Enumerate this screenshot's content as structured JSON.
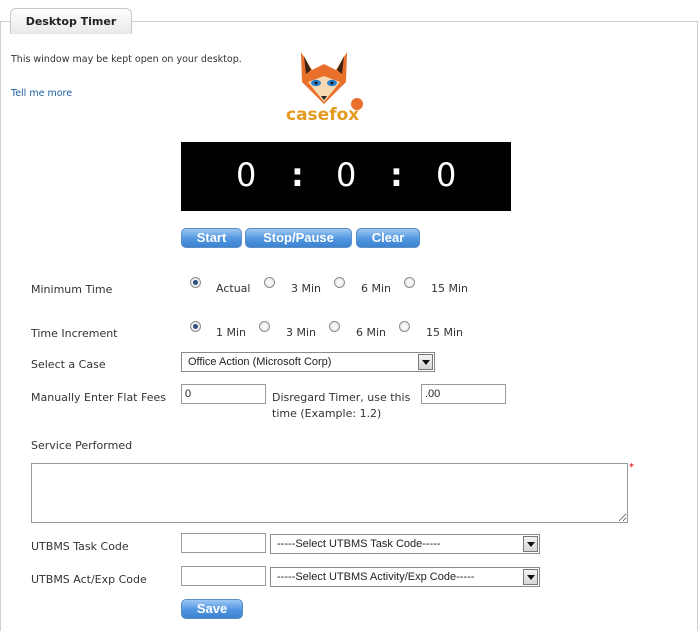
{
  "header": {
    "tab_title": "Desktop Timer"
  },
  "intro": {
    "text": "This window may be kept open on your desktop.",
    "link": "Tell me more"
  },
  "logo": {
    "text": "casefox"
  },
  "timer": {
    "hours": "0",
    "minutes": "0",
    "seconds": "0",
    "separator": ":"
  },
  "controls": {
    "start": "Start",
    "stop": "Stop/Pause",
    "clear": "Clear"
  },
  "minimum_time": {
    "label": "Minimum Time",
    "options": [
      "Actual",
      "3 Min",
      "6 Min",
      "15 Min"
    ],
    "selected": "Actual"
  },
  "time_increment": {
    "label": "Time Increment",
    "options": [
      "1 Min",
      "3 Min",
      "6 Min",
      "15 Min"
    ],
    "selected": "1 Min"
  },
  "case": {
    "label": "Select a Case",
    "value": "Office Action (Microsoft Corp)"
  },
  "flat_fees": {
    "label": "Manually Enter Flat Fees",
    "value": "0",
    "disregard_line1": "Disregard Timer, use this",
    "disregard_line2": "time (Example: 1.2)",
    "time_value": ".00"
  },
  "service": {
    "label": "Service Performed",
    "required_mark": "*"
  },
  "utbms_task": {
    "label": "UTBMS Task Code",
    "select_value": "-----Select UTBMS Task Code-----"
  },
  "utbms_act": {
    "label": "UTBMS Act/Exp Code",
    "select_value": "-----Select UTBMS Activity/Exp Code-----"
  },
  "save": {
    "label": "Save"
  }
}
